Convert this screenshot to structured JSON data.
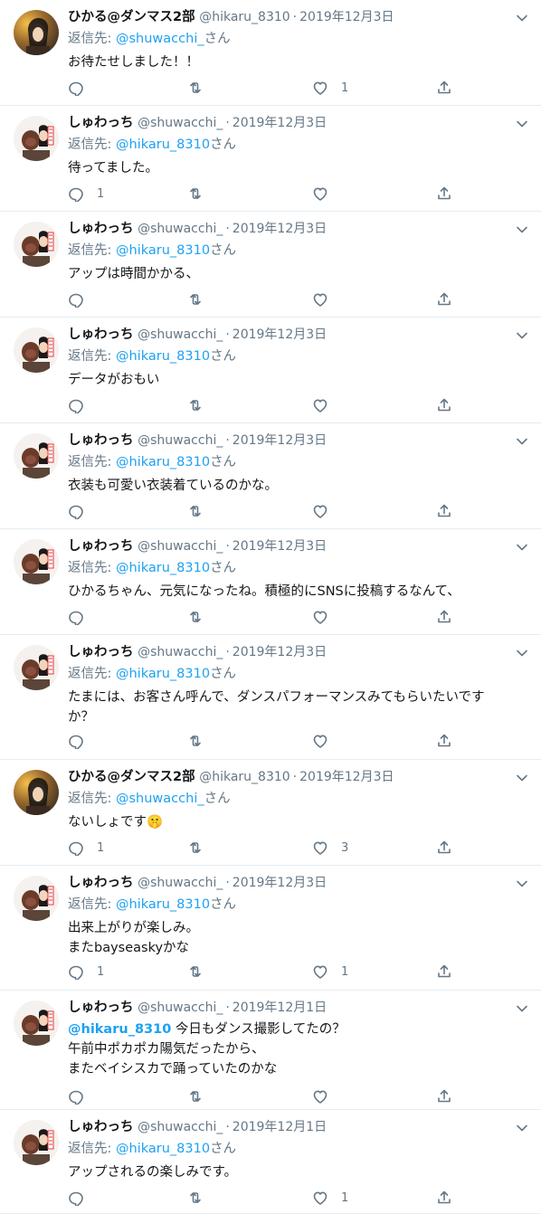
{
  "colors": {
    "link": "#1da1f2",
    "muted": "#657786",
    "text": "#14171a",
    "divider": "#e6ecf0"
  },
  "icons": {
    "reply": "reply-icon",
    "retweet": "retweet-icon",
    "like": "like-icon",
    "share": "share-icon",
    "more": "chevron-down-icon"
  },
  "tweets": [
    {
      "name": "ひかる@ダンマス2部",
      "handle": "@hikaru_8310",
      "dot": "·",
      "date": "2019年12月3日",
      "reply_prefix": "返信先: ",
      "reply_to": "@shuwacchi_",
      "reply_suffix": "さん",
      "lines": [
        "お待たせしました！！"
      ],
      "reply_count": "",
      "retweet_count": "",
      "like_count": "1"
    },
    {
      "name": "しゅわっち",
      "handle": "@shuwacchi_",
      "dot": "·",
      "date": "2019年12月3日",
      "reply_prefix": "返信先: ",
      "reply_to": "@hikaru_8310",
      "reply_suffix": "さん",
      "lines": [
        "待ってました。"
      ],
      "reply_count": "1",
      "retweet_count": "",
      "like_count": ""
    },
    {
      "name": "しゅわっち",
      "handle": "@shuwacchi_",
      "dot": "·",
      "date": "2019年12月3日",
      "reply_prefix": "返信先: ",
      "reply_to": "@hikaru_8310",
      "reply_suffix": "さん",
      "lines": [
        "アップは時間かかる、"
      ],
      "reply_count": "",
      "retweet_count": "",
      "like_count": ""
    },
    {
      "name": "しゅわっち",
      "handle": "@shuwacchi_",
      "dot": "·",
      "date": "2019年12月3日",
      "reply_prefix": "返信先: ",
      "reply_to": "@hikaru_8310",
      "reply_suffix": "さん",
      "lines": [
        "データがおもい"
      ],
      "reply_count": "",
      "retweet_count": "",
      "like_count": ""
    },
    {
      "name": "しゅわっち",
      "handle": "@shuwacchi_",
      "dot": "·",
      "date": "2019年12月3日",
      "reply_prefix": "返信先: ",
      "reply_to": "@hikaru_8310",
      "reply_suffix": "さん",
      "lines": [
        "衣装も可愛い衣装着ているのかな。"
      ],
      "reply_count": "",
      "retweet_count": "",
      "like_count": ""
    },
    {
      "name": "しゅわっち",
      "handle": "@shuwacchi_",
      "dot": "·",
      "date": "2019年12月3日",
      "reply_prefix": "返信先: ",
      "reply_to": "@hikaru_8310",
      "reply_suffix": "さん",
      "lines": [
        "ひかるちゃん、元気になったね。積極的にSNSに投稿するなんて、"
      ],
      "reply_count": "",
      "retweet_count": "",
      "like_count": ""
    },
    {
      "name": "しゅわっち",
      "handle": "@shuwacchi_",
      "dot": "·",
      "date": "2019年12月3日",
      "reply_prefix": "返信先: ",
      "reply_to": "@hikaru_8310",
      "reply_suffix": "さん",
      "lines": [
        "たまには、お客さん呼んで、ダンスパフォーマンスみてもらいたいです",
        "か？"
      ],
      "reply_count": "",
      "retweet_count": "",
      "like_count": ""
    },
    {
      "name": "ひかる@ダンマス2部",
      "handle": "@hikaru_8310",
      "dot": "·",
      "date": "2019年12月3日",
      "reply_prefix": "返信先: ",
      "reply_to": "@shuwacchi_",
      "reply_suffix": "さん",
      "lines": [
        "ないしょです🤫"
      ],
      "reply_count": "1",
      "retweet_count": "",
      "like_count": "3"
    },
    {
      "name": "しゅわっち",
      "handle": "@shuwacchi_",
      "dot": "·",
      "date": "2019年12月3日",
      "reply_prefix": "返信先: ",
      "reply_to": "@hikaru_8310",
      "reply_suffix": "さん",
      "lines": [
        "出来上がりが楽しみ。",
        "またbayseaskyかな"
      ],
      "reply_count": "1",
      "retweet_count": "",
      "like_count": "1"
    },
    {
      "name": "しゅわっち",
      "handle": "@shuwacchi_",
      "dot": "·",
      "date": "2019年12月1日",
      "reply_prefix": "",
      "reply_to": "",
      "reply_suffix": "",
      "mention_inline": "@hikaru_8310",
      "lines": [
        " 今日もダンス撮影してたの？",
        "午前中ポカポカ陽気だったから、",
        "またベイシスカで踊っていたのかな"
      ],
      "reply_count": "",
      "retweet_count": "",
      "like_count": ""
    },
    {
      "name": "しゅわっち",
      "handle": "@shuwacchi_",
      "dot": "·",
      "date": "2019年12月1日",
      "reply_prefix": "返信先: ",
      "reply_to": "@hikaru_8310",
      "reply_suffix": "さん",
      "lines": [
        "アップされるの楽しみです。"
      ],
      "reply_count": "",
      "retweet_count": "",
      "like_count": "1"
    }
  ]
}
